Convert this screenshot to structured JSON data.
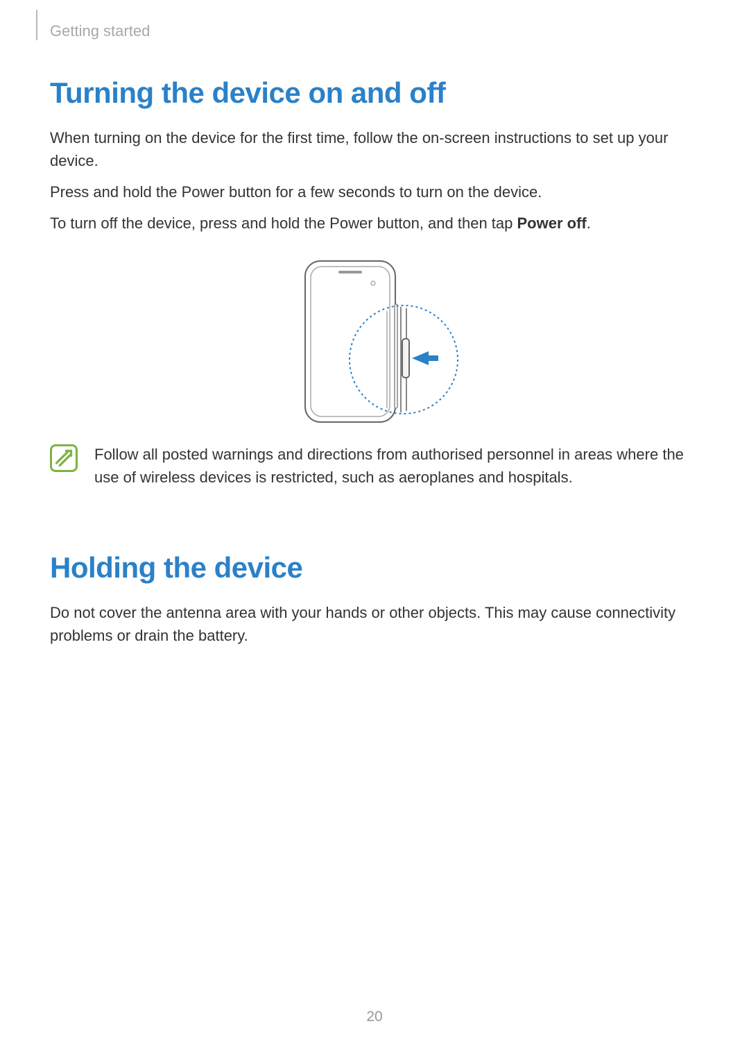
{
  "breadcrumb": "Getting started",
  "section1": {
    "heading": "Turning the device on and off",
    "p1": "When turning on the device for the first time, follow the on-screen instructions to set up your device.",
    "p2": "Press and hold the Power button for a few seconds to turn on the device.",
    "p3_prefix": "To turn off the device, press and hold the Power button, and then tap ",
    "p3_bold": "Power off",
    "p3_suffix": ".",
    "note": "Follow all posted warnings and directions from authorised personnel in areas where the use of wireless devices is restricted, such as aeroplanes and hospitals."
  },
  "section2": {
    "heading": "Holding the device",
    "p1": "Do not cover the antenna area with your hands or other objects. This may cause connectivity problems or drain the battery."
  },
  "page_number": "20"
}
